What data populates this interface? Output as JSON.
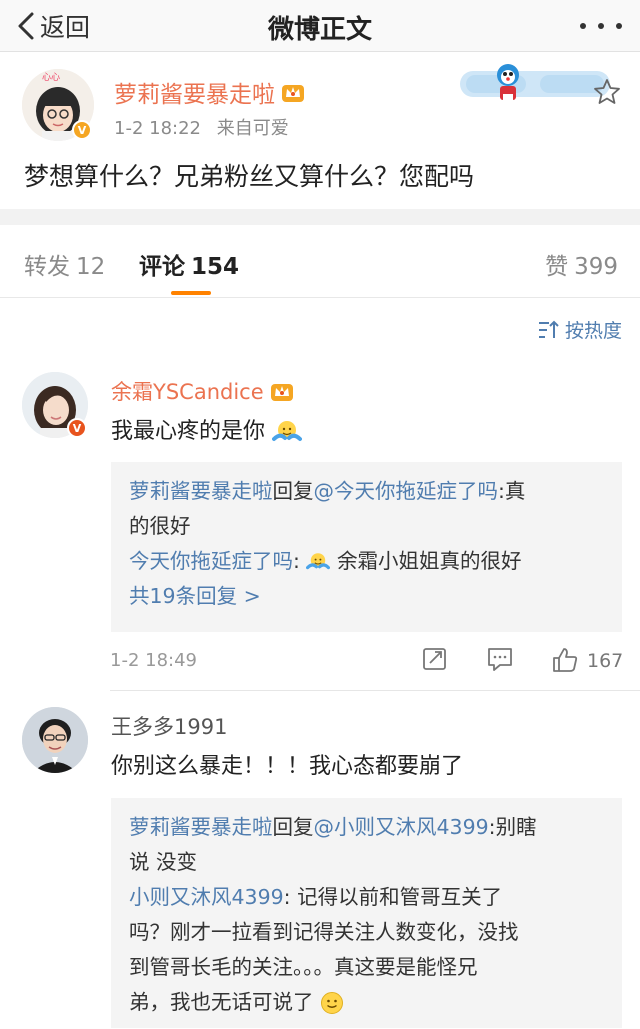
{
  "nav": {
    "back_label": "返回",
    "title": "微博正文"
  },
  "post": {
    "author": "萝莉酱要暴走啦",
    "time": "1-2 18:22",
    "source": "来自可爱",
    "text": "梦想算什么？兄弟粉丝又算什么？您配吗",
    "avatar_caption": "心心"
  },
  "tabs": {
    "repost_label": "转发",
    "repost_count": "12",
    "comment_label": "评论",
    "comment_count": "154",
    "like_label": "赞",
    "like_count": "399"
  },
  "sort_label": "按热度",
  "comments": [
    {
      "name": "余霜YSCandice",
      "text": "我最心疼的是你",
      "replies": {
        "r1_user": "萝莉酱要暴走啦",
        "r1_verb": "回复",
        "r1_mention": "@今天你拖延症了吗",
        "r1_text_a": ":真",
        "r1_text_b": "的很好",
        "r2_user": "今天你拖延症了吗",
        "r2_text": "余霜小姐姐真的很好",
        "more": "共19条回复 >"
      },
      "time": "1-2 18:49",
      "likes": "167"
    },
    {
      "name": "王多多1991",
      "text": "你别这么暴走！！！我心态都要崩了",
      "replies": {
        "r1_user": "萝莉酱要暴走啦",
        "r1_verb": "回复",
        "r1_mention": "@小则又沐风4399",
        "r1_text_a": ":别瞎",
        "r1_text_b": "说 没变",
        "r2_user": "小则又沐风4399",
        "r2_text_a": "记得以前和管哥互关了",
        "r2_text_b": "吗？刚才一拉看到记得关注人数变化，没找",
        "r2_text_c": "到管哥长毛的关注。。。真这要是能怪兄",
        "r2_text_d": "弟，我也无话可说了"
      }
    }
  ],
  "colors": {
    "accent": "#ff8200",
    "name_orange": "#eb7350",
    "link_blue": "#507daf",
    "gray_text": "#8a8a8a"
  },
  "icons": [
    "chevron-left-icon",
    "more-dots-icon",
    "star-icon",
    "crown-icon",
    "sort-icon",
    "repost-icon",
    "comment-icon",
    "like-icon",
    "hug-emoji-icon",
    "smile-emoji-icon"
  ]
}
